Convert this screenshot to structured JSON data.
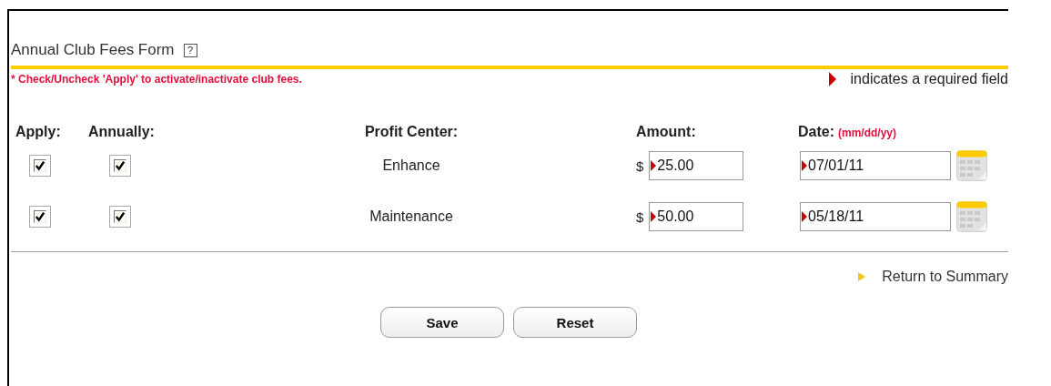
{
  "form": {
    "title": "Annual Club Fees Form",
    "help_icon": "?",
    "note": "* Check/Uncheck 'Apply' to activate/inactivate club fees.",
    "required_legend": "indicates a required field"
  },
  "table": {
    "columns": [
      "Apply:",
      "Annually:",
      "Profit Center:",
      "Amount:",
      "Date:"
    ],
    "date_hint": "(mm/dd/yy)",
    "rows": [
      {
        "apply": true,
        "annually": true,
        "profit_center": "Enhance",
        "currency": "$",
        "amount": "25.00",
        "date": "07/01/11"
      },
      {
        "apply": true,
        "annually": true,
        "profit_center": "Maintenance",
        "currency": "$",
        "amount": "50.00",
        "date": "05/18/11"
      }
    ]
  },
  "return_link": "Return to Summary",
  "buttons": [
    "Save",
    "Reset"
  ]
}
